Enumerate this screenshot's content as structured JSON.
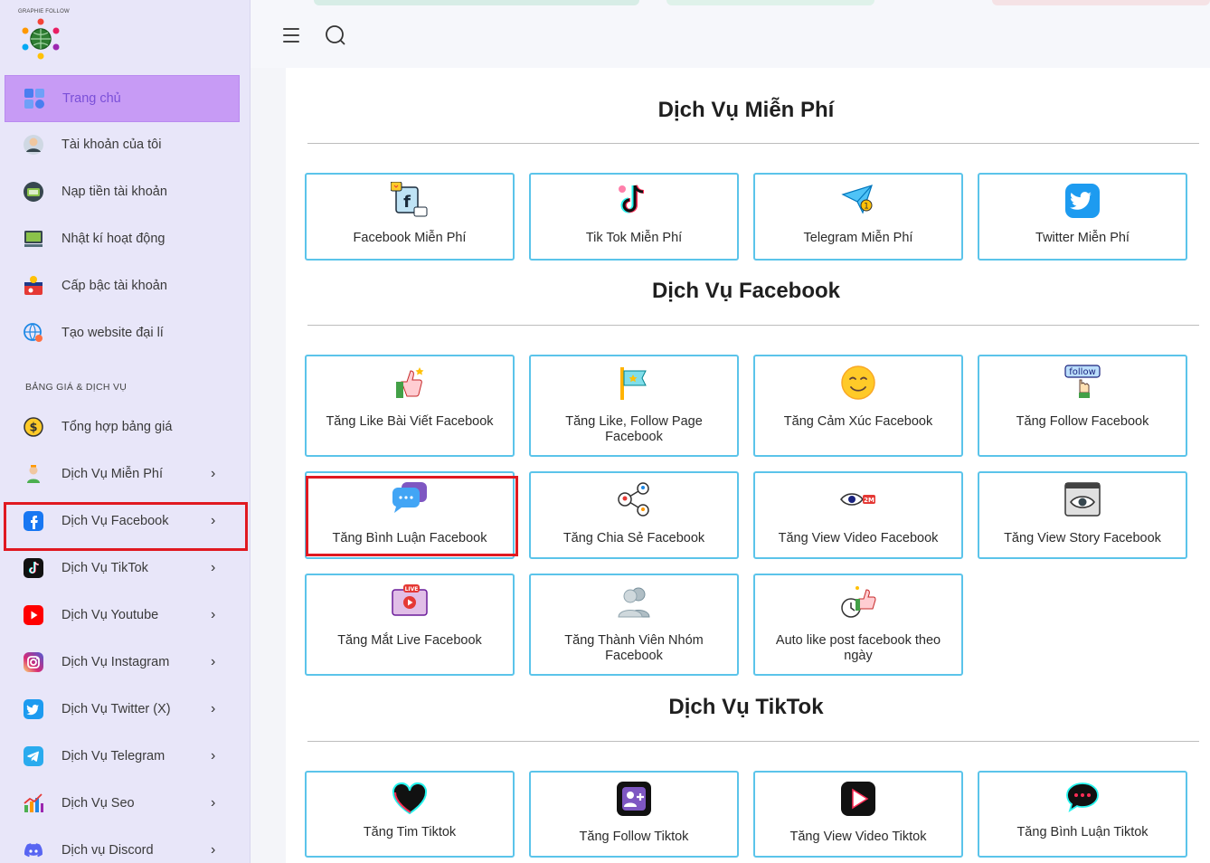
{
  "brand": {
    "logo_text": "GRAPHIE FOLLOW"
  },
  "sidebar": {
    "items_top": [
      {
        "label": "Trang chủ",
        "icon": "dashboard-icon"
      },
      {
        "label": "Tài khoản của tôi",
        "icon": "user-account-icon"
      },
      {
        "label": "Nạp tiền tài khoản",
        "icon": "wallet-icon"
      },
      {
        "label": "Nhật kí hoạt động",
        "icon": "activity-log-icon"
      },
      {
        "label": "Cấp bậc tài khoản",
        "icon": "account-level-icon"
      },
      {
        "label": "Tạo website đại lí",
        "icon": "website-icon"
      }
    ],
    "section_label": "BẢNG GIÁ & DỊCH VỤ",
    "items_services": [
      {
        "label": "Tổng hợp bảng giá",
        "icon": "price-list-icon"
      },
      {
        "label": "Dịch Vụ Miễn Phí",
        "icon": "free-service-icon"
      },
      {
        "label": "Dịch Vụ Facebook",
        "icon": "facebook-icon"
      },
      {
        "label": "Dịch Vụ TikTok",
        "icon": "tiktok-icon"
      },
      {
        "label": "Dịch Vụ Youtube",
        "icon": "youtube-icon"
      },
      {
        "label": "Dịch Vụ Instagram",
        "icon": "instagram-icon"
      },
      {
        "label": "Dịch Vụ Twitter (X)",
        "icon": "twitter-icon"
      },
      {
        "label": "Dịch Vụ Telegram",
        "icon": "telegram-icon"
      },
      {
        "label": "Dịch Vụ Seo",
        "icon": "seo-icon"
      },
      {
        "label": "Dịch vụ Discord",
        "icon": "discord-icon"
      }
    ],
    "chevron": "›"
  },
  "sections": {
    "free": {
      "title": "Dịch Vụ Miễn Phí",
      "cards": [
        "Facebook Miễn Phí",
        "Tik Tok Miễn Phí",
        "Telegram Miễn Phí",
        "Twitter Miễn Phí"
      ]
    },
    "facebook": {
      "title": "Dịch Vụ Facebook",
      "cards": [
        "Tăng Like Bài Viết Facebook",
        "Tăng Like, Follow Page Facebook",
        "Tăng Cảm Xúc Facebook",
        "Tăng Follow Facebook",
        "Tăng Bình Luận Facebook",
        "Tăng Chia Sẻ Facebook",
        "Tăng View Video Facebook",
        "Tăng View Story Facebook",
        "Tăng Mắt Live Facebook",
        "Tăng Thành Viên Nhóm Facebook",
        "Auto like post facebook theo ngày"
      ]
    },
    "tiktok": {
      "title": "Dịch Vụ TikTok",
      "cards": [
        "Tăng Tim Tiktok",
        "Tăng Follow Tiktok",
        "Tăng View Video Tiktok",
        "Tăng Bình Luận Tiktok"
      ]
    }
  },
  "icon_labels": {
    "follow_badge": "follow",
    "view_badge": "2M",
    "live_badge": "LIVE"
  },
  "colors": {
    "accent": "#5bc4ea",
    "highlight": "#e01921",
    "active_nav": "#c79bf5",
    "sidebar_bg": "#e8e6f9"
  }
}
